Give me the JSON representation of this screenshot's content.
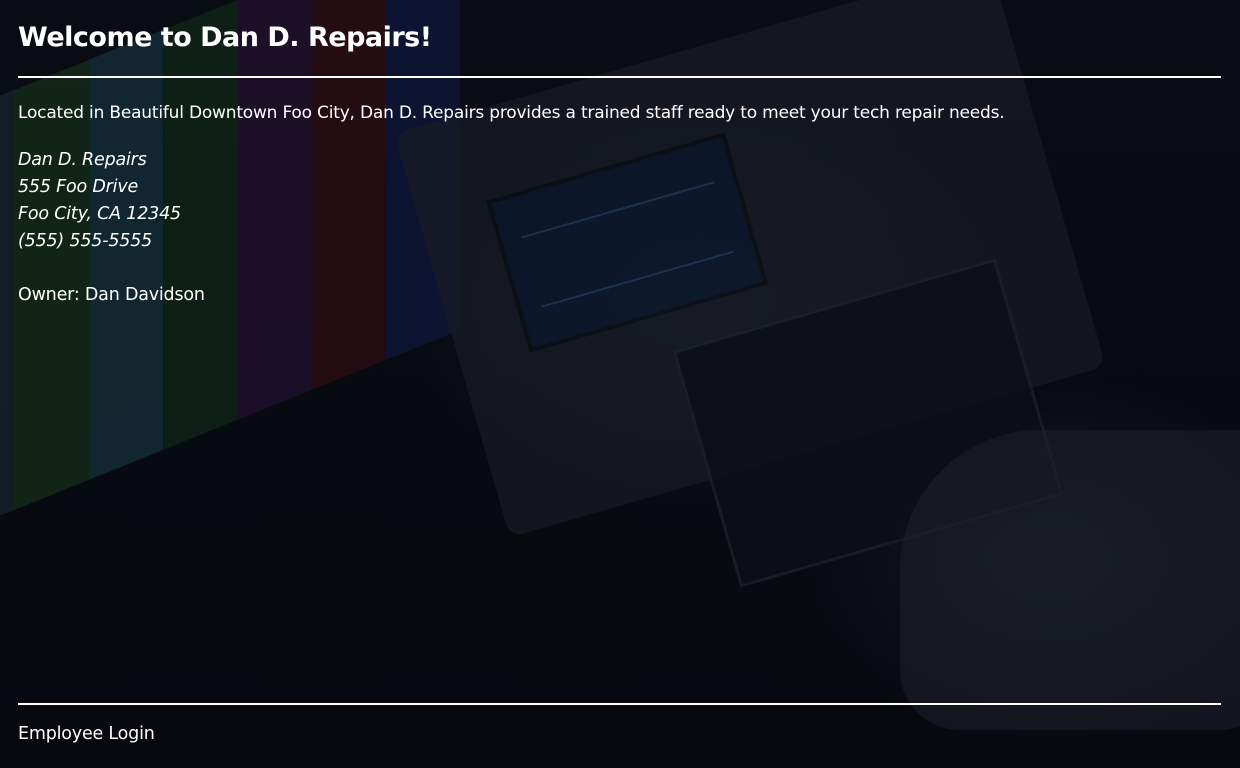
{
  "header": {
    "title": "Welcome to Dan D. Repairs!"
  },
  "main": {
    "intro": "Located in Beautiful Downtown Foo City, Dan D. Repairs provides a trained staff ready to meet your tech repair needs.",
    "address": {
      "business_name": "Dan D. Repairs",
      "street": "555 Foo Drive",
      "city_state_zip": "Foo City, CA 12345",
      "phone": "(555) 555-5555"
    },
    "owner": "Owner: Dan Davidson"
  },
  "footer": {
    "login_link": "Employee Login"
  },
  "colors": {
    "text": "#ffffff",
    "background": "#05070d",
    "test_bars": [
      "#1e2a3c",
      "#1a3a1a",
      "#1a3d4a",
      "#123018",
      "#2a143a",
      "#3a0d10",
      "#101c4a"
    ]
  }
}
